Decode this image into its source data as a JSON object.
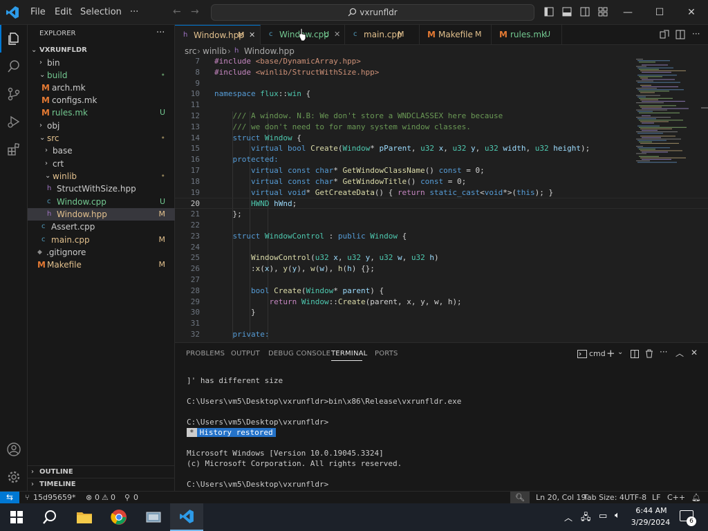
{
  "titlebar": {
    "menus": [
      "File",
      "Edit",
      "Selection"
    ],
    "more": "···",
    "search": "vxrunfldr",
    "minimize": "—",
    "maximize": "☐",
    "close": "✕"
  },
  "explorer": {
    "title": "EXPLORER",
    "more": "···",
    "root": "VXRUNFLDR",
    "items": [
      {
        "label": "bin",
        "badge": ""
      },
      {
        "label": "build",
        "badge": "•"
      },
      {
        "label": "arch.mk",
        "badge": ""
      },
      {
        "label": "configs.mk",
        "badge": ""
      },
      {
        "label": "rules.mk",
        "badge": "U"
      },
      {
        "label": "obj",
        "badge": ""
      },
      {
        "label": "src",
        "badge": "•"
      },
      {
        "label": "base",
        "badge": ""
      },
      {
        "label": "crt",
        "badge": ""
      },
      {
        "label": "winlib",
        "badge": "•"
      },
      {
        "label": "StructWithSize.hpp",
        "badge": ""
      },
      {
        "label": "Window.cpp",
        "badge": "U"
      },
      {
        "label": "Window.hpp",
        "badge": "M"
      },
      {
        "label": "Assert.cpp",
        "badge": ""
      },
      {
        "label": "main.cpp",
        "badge": "M"
      },
      {
        "label": ".gitignore",
        "badge": ""
      },
      {
        "label": "Makefile",
        "badge": "M"
      }
    ],
    "outline": "OUTLINE",
    "timeline": "TIMELINE"
  },
  "tabs": [
    {
      "label": "Window.hpp",
      "badge": "M",
      "close": "✕"
    },
    {
      "label": "Window.cpp",
      "badge": "U",
      "close": "✕"
    },
    {
      "label": "main.cpp",
      "badge": "M"
    },
    {
      "label": "Makefile",
      "badge": "M"
    },
    {
      "label": "rules.mk",
      "badge": "U"
    }
  ],
  "breadcrumb": [
    "src",
    "winlib",
    "Window.hpp"
  ],
  "editor": {
    "line_numbers": [
      "7",
      "8",
      "9",
      "10",
      "11",
      "12",
      "13",
      "14",
      "15",
      "16",
      "17",
      "18",
      "19",
      "20",
      "21",
      "22",
      "23",
      "24",
      "25",
      "26",
      "27",
      "28",
      "29",
      "30",
      "31",
      "32"
    ],
    "lines": [
      [
        [
          "pp",
          "#include"
        ],
        [
          "n",
          " "
        ],
        [
          "s",
          "<base/DynamicArray.hpp>"
        ]
      ],
      [
        [
          "pp",
          "#include"
        ],
        [
          "n",
          " "
        ],
        [
          "s",
          "<winlib/StructWithSize.hpp>"
        ]
      ],
      [],
      [
        [
          "k",
          "namespace"
        ],
        [
          "n",
          " "
        ],
        [
          "t",
          "flux"
        ],
        [
          "n",
          "::"
        ],
        [
          "t",
          "win"
        ],
        [
          "n",
          " {"
        ]
      ],
      [],
      [
        [
          "n",
          "    "
        ],
        [
          "c",
          "/// A window. N.B: We don't store a WNDCLASSEX here because"
        ]
      ],
      [
        [
          "n",
          "    "
        ],
        [
          "c",
          "/// we don't need to for many system window classes."
        ]
      ],
      [
        [
          "n",
          "    "
        ],
        [
          "k",
          "struct"
        ],
        [
          "n",
          " "
        ],
        [
          "t",
          "Window"
        ],
        [
          "n",
          " {"
        ]
      ],
      [
        [
          "n",
          "        "
        ],
        [
          "k",
          "virtual"
        ],
        [
          "n",
          " "
        ],
        [
          "k",
          "bool"
        ],
        [
          "n",
          " "
        ],
        [
          "f",
          "Create"
        ],
        [
          "n",
          "("
        ],
        [
          "t",
          "Window"
        ],
        [
          "n",
          "* "
        ],
        [
          "p",
          "pParent"
        ],
        [
          "n",
          ", "
        ],
        [
          "t",
          "u32"
        ],
        [
          "n",
          " "
        ],
        [
          "p",
          "x"
        ],
        [
          "n",
          ", "
        ],
        [
          "t",
          "u32"
        ],
        [
          "n",
          " "
        ],
        [
          "p",
          "y"
        ],
        [
          "n",
          ", "
        ],
        [
          "t",
          "u32"
        ],
        [
          "n",
          " "
        ],
        [
          "p",
          "width"
        ],
        [
          "n",
          ", "
        ],
        [
          "t",
          "u32"
        ],
        [
          "n",
          " "
        ],
        [
          "p",
          "height"
        ],
        [
          "n",
          ");"
        ]
      ],
      [
        [
          "n",
          "    "
        ],
        [
          "k",
          "protected:"
        ]
      ],
      [
        [
          "n",
          "        "
        ],
        [
          "k",
          "virtual"
        ],
        [
          "n",
          " "
        ],
        [
          "k",
          "const"
        ],
        [
          "n",
          " "
        ],
        [
          "k",
          "char"
        ],
        [
          "n",
          "* "
        ],
        [
          "f",
          "GetWindowClassName"
        ],
        [
          "n",
          "() "
        ],
        [
          "k",
          "const"
        ],
        [
          "n",
          " = 0;"
        ]
      ],
      [
        [
          "n",
          "        "
        ],
        [
          "k",
          "virtual"
        ],
        [
          "n",
          " "
        ],
        [
          "k",
          "const"
        ],
        [
          "n",
          " "
        ],
        [
          "k",
          "char"
        ],
        [
          "n",
          "* "
        ],
        [
          "f",
          "GetWindowTitle"
        ],
        [
          "n",
          "() "
        ],
        [
          "k",
          "const"
        ],
        [
          "n",
          " = 0;"
        ]
      ],
      [
        [
          "n",
          "        "
        ],
        [
          "k",
          "virtual"
        ],
        [
          "n",
          " "
        ],
        [
          "k",
          "void"
        ],
        [
          "n",
          "* "
        ],
        [
          "f",
          "GetCreateData"
        ],
        [
          "n",
          "() { "
        ],
        [
          "pp",
          "return"
        ],
        [
          "n",
          " "
        ],
        [
          "k",
          "static_cast"
        ],
        [
          "n",
          "<"
        ],
        [
          "k",
          "void"
        ],
        [
          "n",
          "*>("
        ],
        [
          "k",
          "this"
        ],
        [
          "n",
          "); }"
        ]
      ],
      [
        [
          "n",
          "        "
        ],
        [
          "t",
          "HWND"
        ],
        [
          "n",
          " "
        ],
        [
          "p",
          "hWnd"
        ],
        [
          "n",
          ";"
        ]
      ],
      [
        [
          "n",
          "    };"
        ]
      ],
      [],
      [
        [
          "n",
          "    "
        ],
        [
          "k",
          "struct"
        ],
        [
          "n",
          " "
        ],
        [
          "t",
          "WindowControl"
        ],
        [
          "n",
          " : "
        ],
        [
          "k",
          "public"
        ],
        [
          "n",
          " "
        ],
        [
          "t",
          "Window"
        ],
        [
          "n",
          " {"
        ]
      ],
      [],
      [
        [
          "n",
          "        "
        ],
        [
          "f",
          "WindowControl"
        ],
        [
          "n",
          "("
        ],
        [
          "t",
          "u32"
        ],
        [
          "n",
          " "
        ],
        [
          "p",
          "x"
        ],
        [
          "n",
          ", "
        ],
        [
          "t",
          "u32"
        ],
        [
          "n",
          " "
        ],
        [
          "p",
          "y"
        ],
        [
          "n",
          ", "
        ],
        [
          "t",
          "u32"
        ],
        [
          "n",
          " "
        ],
        [
          "p",
          "w"
        ],
        [
          "n",
          ", "
        ],
        [
          "t",
          "u32"
        ],
        [
          "n",
          " "
        ],
        [
          "p",
          "h"
        ],
        [
          "n",
          ")"
        ]
      ],
      [
        [
          "n",
          "        :"
        ],
        [
          "f",
          "x"
        ],
        [
          "n",
          "("
        ],
        [
          "p",
          "x"
        ],
        [
          "n",
          "), "
        ],
        [
          "f",
          "y"
        ],
        [
          "n",
          "("
        ],
        [
          "p",
          "y"
        ],
        [
          "n",
          "), "
        ],
        [
          "f",
          "w"
        ],
        [
          "n",
          "("
        ],
        [
          "p",
          "w"
        ],
        [
          "n",
          "), "
        ],
        [
          "f",
          "h"
        ],
        [
          "n",
          "("
        ],
        [
          "p",
          "h"
        ],
        [
          "n",
          ") {};"
        ]
      ],
      [],
      [
        [
          "n",
          "        "
        ],
        [
          "k",
          "bool"
        ],
        [
          "n",
          " "
        ],
        [
          "f",
          "Create"
        ],
        [
          "n",
          "("
        ],
        [
          "t",
          "Window"
        ],
        [
          "n",
          "* "
        ],
        [
          "p",
          "parent"
        ],
        [
          "n",
          ") {"
        ]
      ],
      [
        [
          "n",
          "            "
        ],
        [
          "pp",
          "return"
        ],
        [
          "n",
          " "
        ],
        [
          "t",
          "Window"
        ],
        [
          "n",
          "::"
        ],
        [
          "f",
          "Create"
        ],
        [
          "n",
          "(parent, x, y, w, h);"
        ]
      ],
      [
        [
          "n",
          "        }"
        ]
      ],
      [],
      [
        [
          "n",
          "    "
        ],
        [
          "k",
          "private:"
        ]
      ]
    ]
  },
  "panel": {
    "tabs": [
      "PROBLEMS",
      "OUTPUT",
      "DEBUG CONSOLE",
      "TERMINAL",
      "PORTS"
    ],
    "terminal_name": "cmd",
    "terminal_lines": [
      "]' has different size",
      "",
      "C:\\Users\\vm5\\Desktop\\vxrunfldr>bin\\x86\\Release\\vxrunfldr.exe",
      "",
      "C:\\Users\\vm5\\Desktop\\vxrunfldr>",
      "",
      "",
      "Microsoft Windows [Version 10.0.19045.3324]",
      "(c) Microsoft Corporation. All rights reserved.",
      "",
      "C:\\Users\\vm5\\Desktop\\vxrunfldr>"
    ],
    "history_star": "*",
    "history_label": "History restored"
  },
  "statusbar": {
    "branch": "15d95659*",
    "errors": "0",
    "warnings": "0",
    "ports": "0",
    "position": "Ln 20, Col 19",
    "tabsize": "Tab Size: 4",
    "encoding": "UTF-8",
    "eol": "LF",
    "language": "C++"
  },
  "taskbar": {
    "time": "6:44 AM",
    "date": "3/29/2024",
    "notifications": "6"
  },
  "colors": {
    "accent": "#0078d4",
    "modified": "#e2c08d",
    "untracked": "#73c991",
    "makefile_icon": "#e37933",
    "history_bg": "#2472c8"
  }
}
